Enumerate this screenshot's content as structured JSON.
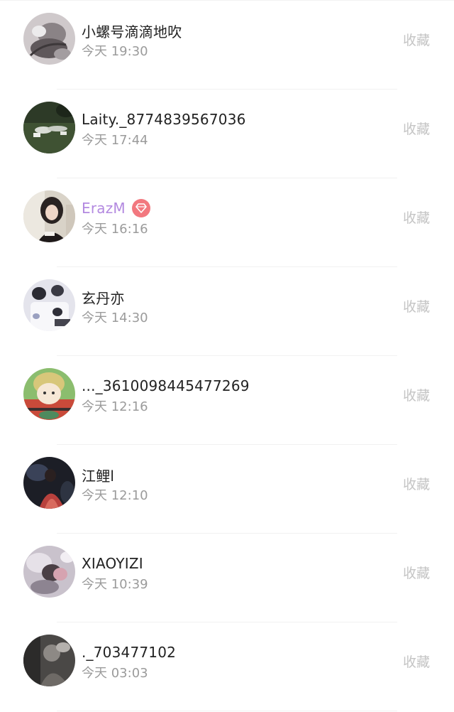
{
  "rows": [
    {
      "name": "小螺号滴滴地吹",
      "time": "今天 19:30",
      "action": "收藏",
      "avatar_icon": "avatar-grey-portrait",
      "vip": false
    },
    {
      "name": "Laity._8774839567036",
      "time": "今天 17:44",
      "action": "收藏",
      "avatar_icon": "avatar-dark-green-grass",
      "vip": false
    },
    {
      "name": "ErazM",
      "time": "今天 16:16",
      "action": "收藏",
      "avatar_icon": "avatar-girl-dark-hair",
      "vip": true,
      "name_color": "#b389e0",
      "badge_color": "#f2787f"
    },
    {
      "name": "玄丹亦",
      "time": "今天 14:30",
      "action": "收藏",
      "avatar_icon": "avatar-cartoon-white",
      "vip": false
    },
    {
      "name": "..._3610098445477269",
      "time": "今天 12:16",
      "action": "收藏",
      "avatar_icon": "avatar-anime-boy",
      "vip": false
    },
    {
      "name": "江鲤l",
      "time": "今天 12:10",
      "action": "收藏",
      "avatar_icon": "avatar-red-dress-dark",
      "vip": false
    },
    {
      "name": "XIAOYIZI",
      "time": "今天 10:39",
      "action": "收藏",
      "avatar_icon": "avatar-snowy-pink",
      "vip": false
    },
    {
      "name": "._703477102",
      "time": "今天 03:03",
      "action": "收藏",
      "avatar_icon": "avatar-dark-grey-figure",
      "vip": false
    }
  ]
}
